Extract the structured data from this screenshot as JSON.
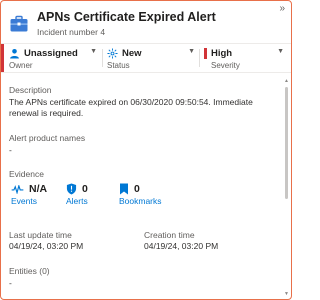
{
  "header": {
    "title": "APNs Certificate Expired Alert",
    "subtitle": "Incident number 4",
    "icon": "briefcase-icon"
  },
  "status_bar": {
    "assignment": {
      "value": "Unassigned",
      "label": "Owner",
      "icon": "person-icon"
    },
    "status": {
      "value": "New",
      "label": "Status",
      "icon": "new-sparkle-icon"
    },
    "severity": {
      "value": "High",
      "label": "Severity",
      "icon": "severity-bar-icon",
      "color": "#d13438"
    }
  },
  "description": {
    "label": "Description",
    "text": "The APNs certificate expired on 06/30/2020 09:50:54. Immediate renewal is required."
  },
  "alert_products": {
    "label": "Alert product names",
    "value": "-"
  },
  "evidence": {
    "label": "Evidence",
    "events": {
      "count": "N/A",
      "label": "Events"
    },
    "alerts": {
      "count": "0",
      "label": "Alerts"
    },
    "bookmarks": {
      "count": "0",
      "label": "Bookmarks"
    }
  },
  "times": {
    "last_update": {
      "label": "Last update time",
      "value": "04/19/24, 03:20 PM"
    },
    "creation": {
      "label": "Creation time",
      "value": "04/19/24, 03:20 PM"
    }
  },
  "entities": {
    "label": "Entities (0)",
    "value": "-"
  },
  "colors": {
    "accent": "#0078d4",
    "severity_high": "#d13438",
    "frame": "#e8704a"
  }
}
